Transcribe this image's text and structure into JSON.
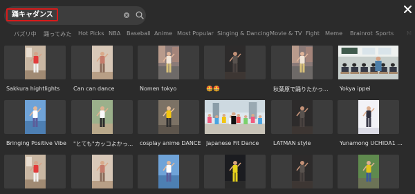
{
  "search": {
    "value": "踊キャダンス"
  },
  "tabs": [
    "バズリ中",
    "踊ってみた",
    "Hot Picks",
    "NBA",
    "Baseball",
    "Anime",
    "Most Popular",
    "Singing & Dancing",
    "Movie & TV",
    "Fight",
    "Meme",
    "Brainrot",
    "Sports",
    "M"
  ],
  "rows": [
    [
      {
        "title": "Sakkura hightlights",
        "scene": "indoor-dancer"
      },
      {
        "title": "Can can dance",
        "scene": "studio-dancer"
      },
      {
        "title": "Nomen tokyo",
        "scene": "street-dancer"
      },
      {
        "title": "🤩🤩",
        "scene": "dark-dancer"
      },
      {
        "title": "秋葉原で踊りたかっ...",
        "scene": "street-dancer"
      },
      {
        "title": "Yokya ippei",
        "scene": "classroom"
      }
    ],
    [
      {
        "title": "Bringing Positive Vibe",
        "scene": "sky-dancer"
      },
      {
        "title": "\"とても\"カッコよかっ...",
        "scene": "outdoor-dancer"
      },
      {
        "title": "cosplay anime DANCE",
        "scene": "yellow-dancer"
      },
      {
        "title": "Japanese Fit Dance",
        "scene": "plaza-group"
      },
      {
        "title": "LATMAN style",
        "scene": "dark-dancer"
      },
      {
        "title": "Yunamong UCHIDA1 ...",
        "scene": "white-dancer"
      }
    ],
    [
      {
        "title": "",
        "scene": "indoor-dancer"
      },
      {
        "title": "",
        "scene": "studio-dancer"
      },
      {
        "title": "",
        "scene": "sky-dancer"
      },
      {
        "title": "",
        "scene": "night-yellow"
      },
      {
        "title": "",
        "scene": "dark-dancer"
      },
      {
        "title": "",
        "scene": "green-dancer"
      }
    ]
  ]
}
